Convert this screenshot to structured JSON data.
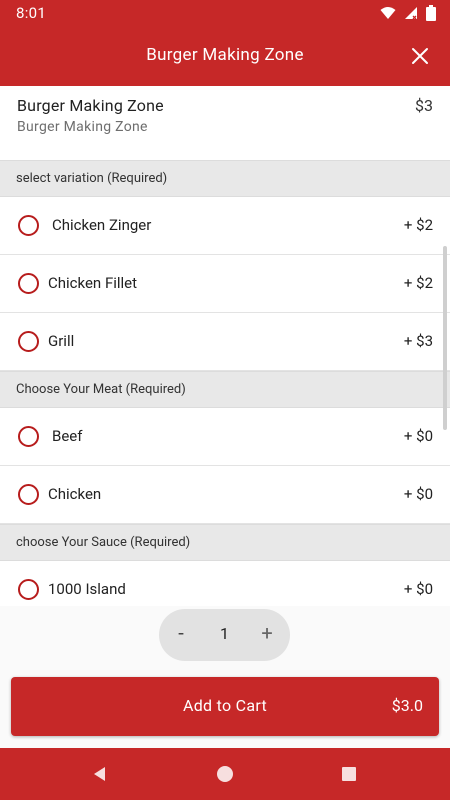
{
  "status_bar": {
    "time": "8:01"
  },
  "app_bar": {
    "title": "Burger Making Zone"
  },
  "product": {
    "name": "Burger Making Zone",
    "subtitle": "Burger Making Zone",
    "price": "$3"
  },
  "sections": [
    {
      "title": "select variation (Required)",
      "options": [
        {
          "label": "Chicken Zinger",
          "price": "+ $2"
        },
        {
          "label": "Chicken Fillet",
          "price": "+ $2"
        },
        {
          "label": "Grill",
          "price": "+ $3"
        }
      ]
    },
    {
      "title": "Choose Your Meat (Required)",
      "options": [
        {
          "label": "Beef",
          "price": "+ $0"
        },
        {
          "label": "Chicken",
          "price": "+ $0"
        }
      ]
    },
    {
      "title": "choose Your Sauce (Required)",
      "options": [
        {
          "label": "1000 Island",
          "price": "+ $0"
        }
      ]
    }
  ],
  "stepper": {
    "minus": "-",
    "quantity": "1",
    "plus": "+"
  },
  "add_to_cart": {
    "label": "Add to Cart",
    "total": "$3.0"
  },
  "colors": {
    "primary": "#c62828",
    "section_bg": "#e8e8e8",
    "radio": "#b71c1c"
  },
  "icons": {
    "status": [
      "wifi-icon",
      "signal-icon",
      "battery-icon"
    ],
    "close": "close-icon",
    "nav": [
      "back-icon",
      "home-icon",
      "recents-icon"
    ]
  }
}
